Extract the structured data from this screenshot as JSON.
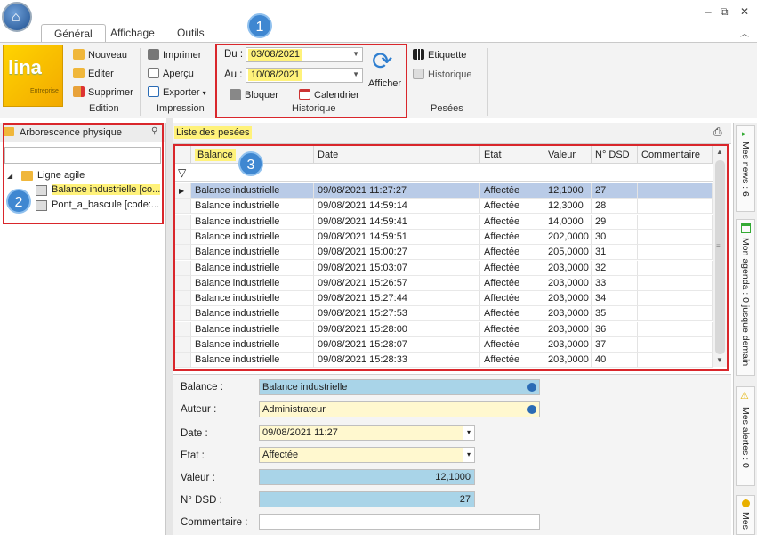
{
  "ribbon": {
    "tabs": [
      "Général",
      "Affichage",
      "Outils"
    ],
    "active_tab": "Général",
    "window_controls": [
      "–",
      "⧉",
      "✕"
    ],
    "brand": {
      "logo_text": "lina",
      "logo_sub": "Entreprise"
    },
    "edition": {
      "label": "Edition",
      "new": "Nouveau",
      "edit": "Editer",
      "delete": "Supprimer"
    },
    "impression": {
      "label": "Impression",
      "print": "Imprimer",
      "preview": "Aperçu",
      "export": "Exporter"
    },
    "historique": {
      "label": "Historique",
      "from_label": "Du :",
      "from_value": "03/08/2021",
      "to_label": "Au :",
      "to_value": "10/08/2021",
      "lock": "Bloquer",
      "calendar": "Calendrier",
      "show": "Afficher"
    },
    "pesees": {
      "label": "Pesées",
      "etiquette": "Etiquette",
      "historique": "Historique"
    }
  },
  "annotations": [
    "1",
    "2",
    "3"
  ],
  "tree": {
    "title": "Arborescence physique",
    "root": "Ligne agile",
    "children": [
      "Balance industrielle [co...",
      "Pont_a_bascule [code:..."
    ]
  },
  "list": {
    "title": "Liste des pesées",
    "columns": [
      "Balance",
      "Date",
      "Etat",
      "Valeur",
      "N° DSD",
      "Commentaire"
    ],
    "rows": [
      [
        "Balance industrielle",
        "09/08/2021 11:27:27",
        "Affectée",
        "12,1000",
        "27",
        ""
      ],
      [
        "Balance industrielle",
        "09/08/2021 14:59:14",
        "Affectée",
        "12,3000",
        "28",
        ""
      ],
      [
        "Balance industrielle",
        "09/08/2021 14:59:41",
        "Affectée",
        "14,0000",
        "29",
        ""
      ],
      [
        "Balance industrielle",
        "09/08/2021 14:59:51",
        "Affectée",
        "202,0000",
        "30",
        ""
      ],
      [
        "Balance industrielle",
        "09/08/2021 15:00:27",
        "Affectée",
        "205,0000",
        "31",
        ""
      ],
      [
        "Balance industrielle",
        "09/08/2021 15:03:07",
        "Affectée",
        "203,0000",
        "32",
        ""
      ],
      [
        "Balance industrielle",
        "09/08/2021 15:26:57",
        "Affectée",
        "203,0000",
        "33",
        ""
      ],
      [
        "Balance industrielle",
        "09/08/2021 15:27:44",
        "Affectée",
        "203,0000",
        "34",
        ""
      ],
      [
        "Balance industrielle",
        "09/08/2021 15:27:53",
        "Affectée",
        "203,0000",
        "35",
        ""
      ],
      [
        "Balance industrielle",
        "09/08/2021 15:28:00",
        "Affectée",
        "203,0000",
        "36",
        ""
      ],
      [
        "Balance industrielle",
        "09/08/2021 15:28:07",
        "Affectée",
        "203,0000",
        "37",
        ""
      ],
      [
        "Balance industrielle",
        "09/08/2021 15:28:33",
        "Affectée",
        "203,0000",
        "40",
        ""
      ]
    ]
  },
  "detail": {
    "balance_label": "Balance :",
    "balance_value": "Balance industrielle",
    "auteur_label": "Auteur :",
    "auteur_value": "Administrateur",
    "date_label": "Date :",
    "date_value": "09/08/2021 11:27",
    "etat_label": "Etat :",
    "etat_value": "Affectée",
    "valeur_label": "Valeur :",
    "valeur_value": "12,1000",
    "dsd_label": "N° DSD :",
    "dsd_value": "27",
    "commentaire_label": "Commentaire :",
    "commentaire_value": ""
  },
  "side_tabs": [
    "Mes news : 6",
    "Mon agenda : 0 jusque demain",
    "Mes alertes : 0",
    "Mes"
  ],
  "colors": {
    "highlight": "#fff27a",
    "annotation_red": "#d9262b",
    "badge_blue": "#3f87d1",
    "selected_row": "#b9cbe7"
  }
}
